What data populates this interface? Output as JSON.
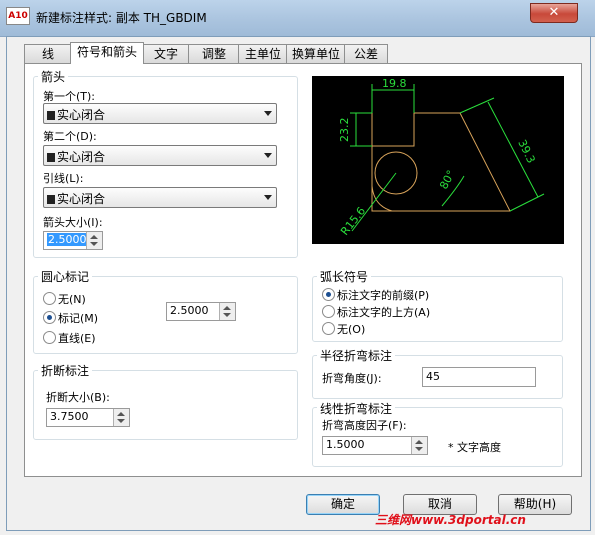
{
  "window": {
    "title": "新建标注样式: 副本 TH_GBDIM",
    "app_icon": "A10",
    "close_glyph": "✕"
  },
  "tabs": [
    "线",
    "符号和箭头",
    "文字",
    "调整",
    "主单位",
    "换算单位",
    "公差"
  ],
  "arrowheads": {
    "group": "箭头",
    "first_label": "第一个(T):",
    "first_value": "实心闭合",
    "second_label": "第二个(D):",
    "second_value": "实心闭合",
    "leader_label": "引线(L):",
    "leader_value": "实心闭合",
    "size_label": "箭头大小(I):",
    "size_value": "2.5000"
  },
  "center_marks": {
    "group": "圆心标记",
    "options": [
      "无(N)",
      "标记(M)",
      "直线(E)"
    ],
    "selected": 1,
    "size_value": "2.5000"
  },
  "dim_break": {
    "group": "折断标注",
    "size_label": "折断大小(B):",
    "size_value": "3.7500"
  },
  "arc_length": {
    "group": "弧长符号",
    "options": [
      "标注文字的前缀(P)",
      "标注文字的上方(A)",
      "无(O)"
    ],
    "selected": 0
  },
  "radius_jog": {
    "group": "半径折弯标注",
    "angle_label": "折弯角度(J):",
    "angle_value": "45"
  },
  "linear_jog": {
    "group": "线性折弯标注",
    "factor_label": "折弯高度因子(F):",
    "factor_value": "1.5000",
    "suffix": "* 文字高度"
  },
  "preview": {
    "dim_top": "19.8",
    "dim_left": "23.2",
    "dim_slant": "39.3",
    "angle": "80°",
    "radius": "R15.6"
  },
  "buttons": {
    "ok": "确定",
    "cancel": "取消",
    "help": "帮助(H)"
  },
  "watermark": "三维网www.3dportal.cn"
}
